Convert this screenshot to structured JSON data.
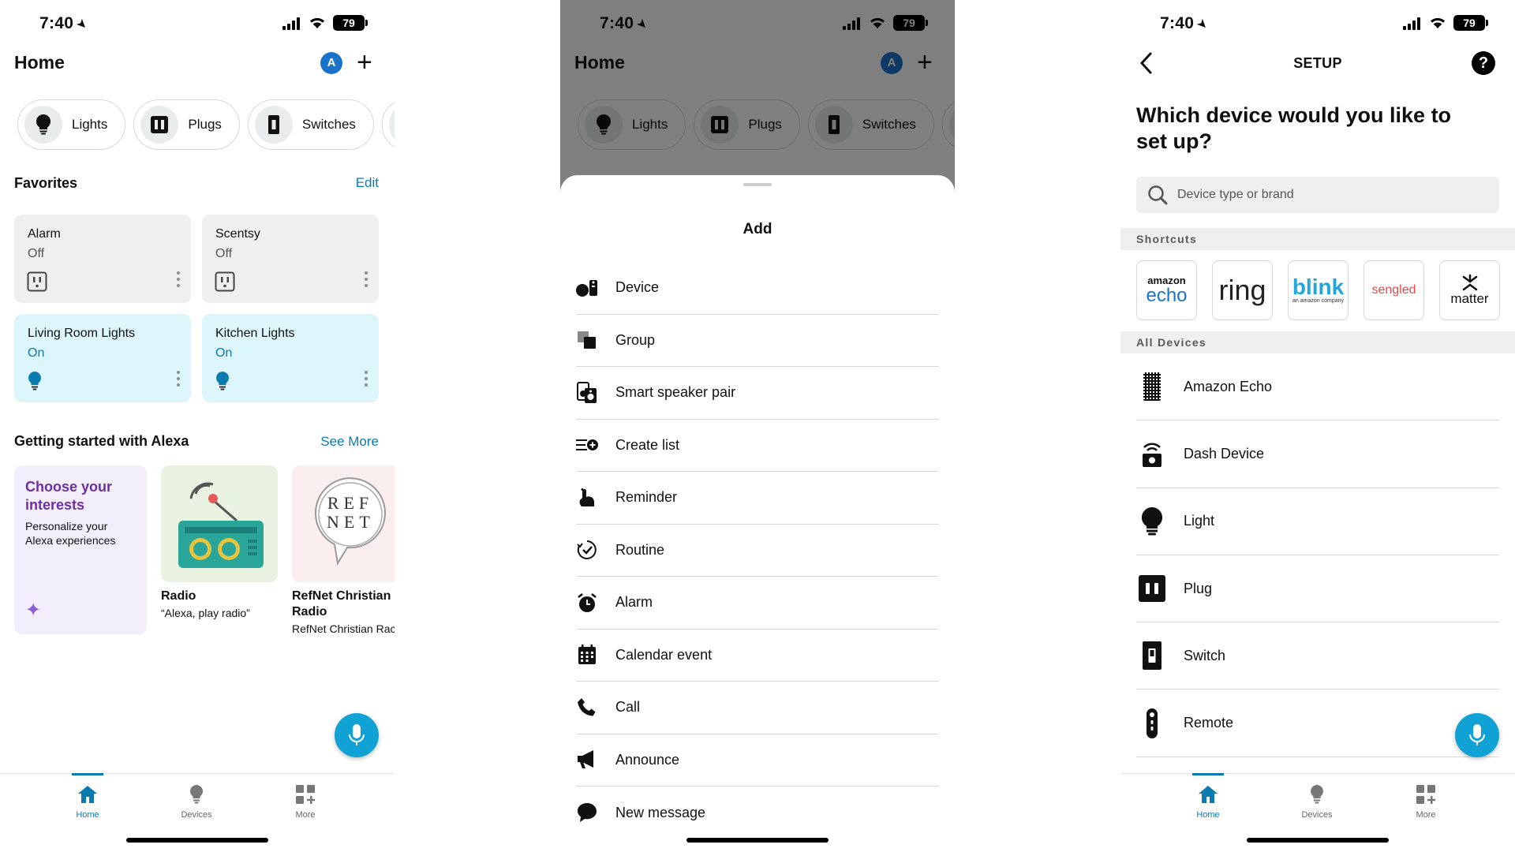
{
  "status": {
    "time": "7:40",
    "battery": "79"
  },
  "home": {
    "title": "Home",
    "avatar_initial": "A",
    "chips": [
      {
        "label": "Lights",
        "icon": "lightbulb-icon"
      },
      {
        "label": "Plugs",
        "icon": "plug-icon"
      },
      {
        "label": "Switches",
        "icon": "switch-icon"
      }
    ],
    "favorites": {
      "title": "Favorites",
      "edit_label": "Edit",
      "items": [
        {
          "name": "Alarm",
          "state": "Off",
          "icon": "plug-icon"
        },
        {
          "name": "Scentsy",
          "state": "Off",
          "icon": "plug-icon"
        },
        {
          "name": "Living Room Lights",
          "state": "On",
          "icon": "lightbulb-icon"
        },
        {
          "name": "Kitchen Lights",
          "state": "On",
          "icon": "lightbulb-icon"
        }
      ]
    },
    "getting_started": {
      "title": "Getting started with Alexa",
      "see_more_label": "See More",
      "cards": [
        {
          "title": "Choose your interests",
          "subtitle": "Personalize your Alexa experiences"
        },
        {
          "title": "Radio",
          "subtitle": "“Alexa, play radio”"
        },
        {
          "title": "RefNet Christian Radio",
          "subtitle": "RefNet Christian Rac",
          "logo_text": "REF NET"
        }
      ]
    }
  },
  "tabs": [
    {
      "label": "Home",
      "icon": "home-icon"
    },
    {
      "label": "Devices",
      "icon": "lightbulb-icon"
    },
    {
      "label": "More",
      "icon": "grid-plus-icon"
    }
  ],
  "add_sheet": {
    "title": "Add",
    "items": [
      {
        "label": "Device",
        "icon": "device-icon"
      },
      {
        "label": "Group",
        "icon": "group-icon"
      },
      {
        "label": "Smart speaker pair",
        "icon": "speaker-pair-icon"
      },
      {
        "label": "Create list",
        "icon": "create-list-icon"
      },
      {
        "label": "Reminder",
        "icon": "reminder-icon"
      },
      {
        "label": "Routine",
        "icon": "routine-icon"
      },
      {
        "label": "Alarm",
        "icon": "alarm-icon"
      },
      {
        "label": "Calendar event",
        "icon": "calendar-icon"
      },
      {
        "label": "Call",
        "icon": "phone-icon"
      },
      {
        "label": "Announce",
        "icon": "megaphone-icon"
      },
      {
        "label": "New message",
        "icon": "message-icon"
      }
    ]
  },
  "setup": {
    "title": "SETUP",
    "help_label": "?",
    "question": "Which device would you like to set up?",
    "search_placeholder": "Device type or brand",
    "shortcuts_label": "Shortcuts",
    "shortcuts": [
      {
        "brand": "amazon",
        "name": "echo"
      },
      {
        "brand": "",
        "name": "ring"
      },
      {
        "brand": "an amazon company",
        "name": "blink"
      },
      {
        "brand": "",
        "name": "sengled"
      },
      {
        "brand": "",
        "name": "matter"
      }
    ],
    "all_devices_label": "All Devices",
    "devices": [
      {
        "label": "Amazon Echo",
        "icon": "echo-speaker-icon"
      },
      {
        "label": "Dash Device",
        "icon": "dash-device-icon"
      },
      {
        "label": "Light",
        "icon": "lightbulb-icon"
      },
      {
        "label": "Plug",
        "icon": "plug-icon"
      },
      {
        "label": "Switch",
        "icon": "switch-icon"
      },
      {
        "label": "Remote",
        "icon": "remote-icon"
      }
    ]
  },
  "colors": {
    "accent": "#0a7bb0",
    "fab": "#10a2d4",
    "favorite_on_bg": "#dcf6fc",
    "interest_purple": "#6a2fa3"
  }
}
